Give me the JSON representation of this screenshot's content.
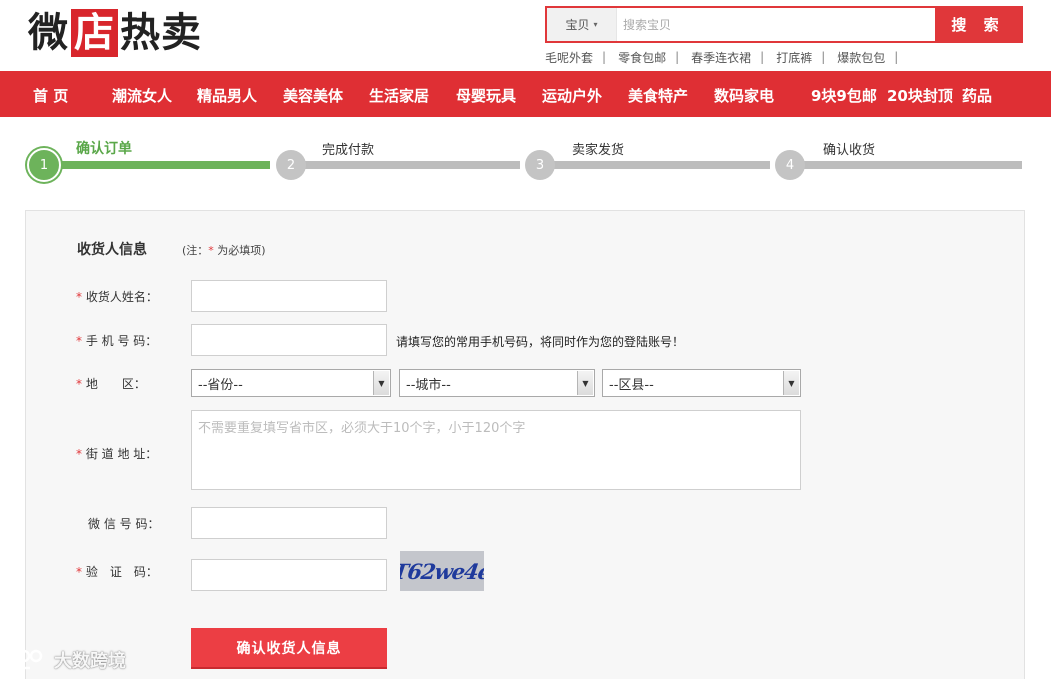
{
  "header": {
    "logo": {
      "part1": "微",
      "boxed": "店",
      "part2": "热卖"
    },
    "search": {
      "type_label": "宝贝",
      "placeholder": "搜索宝贝",
      "button": "搜 索"
    },
    "hot_links": [
      "毛呢外套",
      "零食包邮",
      "春季连衣裙",
      "打底裤",
      "爆款包包"
    ],
    "separator": "|"
  },
  "nav": {
    "items": [
      "首 页",
      "潮流女人",
      "精品男人",
      "美容美体",
      "生活家居",
      "母婴玩具",
      "运动户外",
      "美食特产",
      "数码家电",
      "9块9包邮",
      "20块封顶",
      "药品"
    ]
  },
  "steps": [
    {
      "num": "1",
      "label": "确认订单",
      "active": true
    },
    {
      "num": "2",
      "label": "完成付款",
      "active": false
    },
    {
      "num": "3",
      "label": "卖家发货",
      "active": false
    },
    {
      "num": "4",
      "label": "确认收货",
      "active": false
    }
  ],
  "form": {
    "title": "收货人信息",
    "note_prefix": "(注：",
    "note_star": "*",
    "note_suffix": " 为必填项)",
    "required_mark": "*",
    "fields": {
      "name_label": "收货人姓名：",
      "phone_label": "手 机 号 码：",
      "phone_hint": "请填写您的常用手机号码，将同时作为您的登陆账号！",
      "region_label": "地　　区：",
      "province": "--省份--",
      "city": "--城市--",
      "district": "--区县--",
      "street_label": "街 道 地 址：",
      "street_placeholder": "不需要重复填写省市区，必须大于10个字，小于120个字",
      "wechat_label": "微 信 号 码：",
      "captcha_label": "验　证　码：",
      "captcha_text": "T62we4e"
    },
    "submit": "确认收货人信息"
  },
  "watermark": {
    "text": "大数跨境"
  },
  "colors": {
    "brand_red": "#df2f34",
    "step_green": "#6db35b",
    "step_gray": "#bdbdbd"
  }
}
